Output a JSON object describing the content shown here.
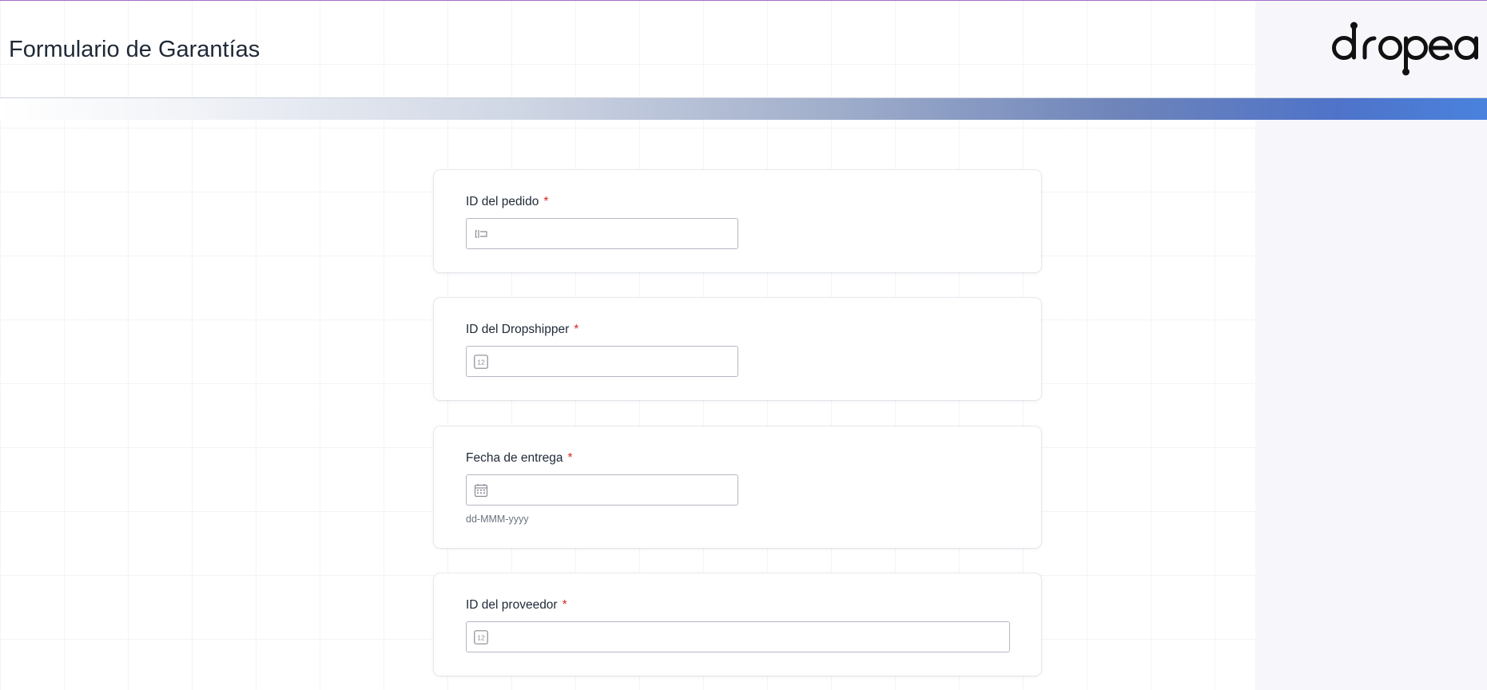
{
  "header": {
    "title": "Formulario de Garantías",
    "logo_text": "dropea"
  },
  "colors": {
    "accent_line": "#a36fc9",
    "gradient_end": "#4a82dd",
    "required": "#dc2626"
  },
  "form": {
    "fields": [
      {
        "label": "ID del pedido",
        "required_mark": "*",
        "value": "",
        "icon": "text-cursor-icon"
      },
      {
        "label": "ID del Dropshipper",
        "required_mark": "*",
        "value": "",
        "icon": "number-icon",
        "icon_text": "12"
      },
      {
        "label": "Fecha de entrega",
        "required_mark": "*",
        "value": "",
        "icon": "calendar-icon",
        "hint": "dd-MMM-yyyy"
      },
      {
        "label": "ID del proveedor",
        "required_mark": "*",
        "value": "",
        "icon": "number-icon",
        "icon_text": "12"
      }
    ]
  }
}
